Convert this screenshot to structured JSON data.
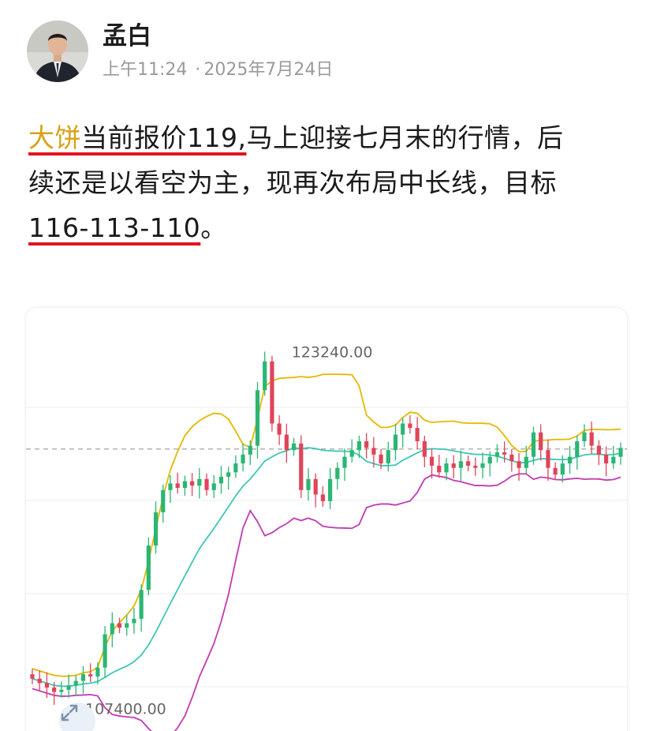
{
  "author": {
    "name": "孟白"
  },
  "meta": {
    "time": "上午11:24",
    "separator": "·",
    "date": "2025年7月24日"
  },
  "content": {
    "highlight": "大饼",
    "underlined_part": "当前报价119,",
    "rest_line1": "马上迎接七月末的行情，后",
    "line2": "续还是以看空为主，现再次布局中长线，目标",
    "targets": "116-113-110",
    "end_punct": "。"
  },
  "colors": {
    "highlight": "#d6a216",
    "underline": "#e0141e",
    "candle_up": "#2bb673",
    "candle_down": "#e0445a",
    "upper_band": "#e6b800",
    "middle_band": "#3ec7b5",
    "lower_band": "#c23ab0"
  },
  "chart_data": {
    "type": "candlestick",
    "max_label": "123240.00",
    "min_label": "107400.00",
    "y_range": [
      106000,
      124500
    ],
    "high": 123240,
    "low": 107400,
    "current_price_line": 118850,
    "candles_close_approx": [
      108500,
      108300,
      108100,
      107900,
      108000,
      108200,
      108400,
      108700,
      108600,
      109000,
      110500,
      111000,
      110800,
      111000,
      111200,
      112500,
      114500,
      116000,
      117000,
      117300,
      117100,
      117400,
      117200,
      117500,
      117000,
      117300,
      117600,
      117800,
      118200,
      118600,
      119000,
      121500,
      122800,
      120000,
      119500,
      118800,
      119100,
      117000,
      117500,
      116800,
      116500,
      117500,
      118000,
      118500,
      118800,
      119200,
      118900,
      118600,
      118200,
      118800,
      119500,
      120000,
      119800,
      119200,
      118500,
      118100,
      117800,
      118200,
      118000,
      118300,
      118100,
      118000,
      118200,
      118500,
      118700,
      118600,
      118300,
      118000,
      118500,
      119600,
      118800,
      118000,
      117700,
      118200,
      118500,
      119200,
      119600,
      119000,
      118600,
      118200,
      118500,
      118900
    ]
  },
  "icons": {
    "expand": "expand-arrows-icon"
  }
}
